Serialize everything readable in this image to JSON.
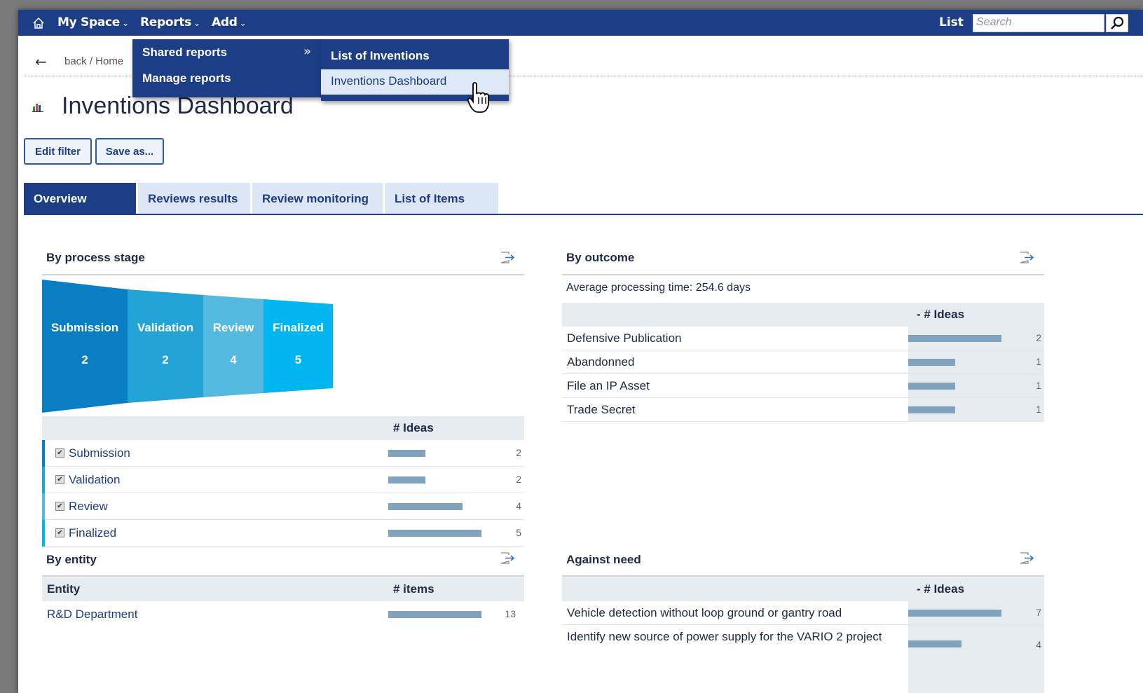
{
  "nav": {
    "my_space": "My Space",
    "reports": "Reports",
    "add": "Add",
    "list": "List",
    "search_placeholder": "Search"
  },
  "breadcrumb": "back / Home",
  "page": {
    "title": "Inventions Dashboard",
    "edit_filter": "Edit filter",
    "save_as": "Save as..."
  },
  "dropdown": {
    "shared_reports": "Shared reports",
    "manage_reports": "Manage reports",
    "submenu_arrow": "»",
    "sub_items": [
      "List of Inventions",
      "Inventions Dashboard"
    ]
  },
  "tabs": [
    "Overview",
    "Reviews results",
    "Review monitoring",
    "List of Items"
  ],
  "process_stage": {
    "title": "By process stage",
    "column": "# Ideas",
    "stages": [
      {
        "name": "Submission",
        "value": 2,
        "color": "#0a7ec2"
      },
      {
        "name": "Validation",
        "value": 2,
        "color": "#23a3d6"
      },
      {
        "name": "Review",
        "value": 4,
        "color": "#55b8df"
      },
      {
        "name": "Finalized",
        "value": 5,
        "color": "#00b5f0"
      }
    ]
  },
  "outcome": {
    "title": "By outcome",
    "avg": "Average processing time: 254.6 days",
    "column": "- # Ideas",
    "rows": [
      {
        "label": "Defensive Publication",
        "value": 2
      },
      {
        "label": "Abandonned",
        "value": 1
      },
      {
        "label": "File an IP Asset",
        "value": 1
      },
      {
        "label": "Trade Secret",
        "value": 1
      }
    ]
  },
  "entity": {
    "title": "By entity",
    "col1": "Entity",
    "col2": "# items",
    "rows": [
      {
        "label": "R&D Department",
        "value": 13
      }
    ]
  },
  "need": {
    "title": "Against need",
    "column": "- # Ideas",
    "rows": [
      {
        "label": "Vehicle detection without loop ground or gantry road",
        "value": 7
      },
      {
        "label": "Identify new source of power supply for the VARIO 2 project",
        "value": 4
      }
    ]
  }
}
